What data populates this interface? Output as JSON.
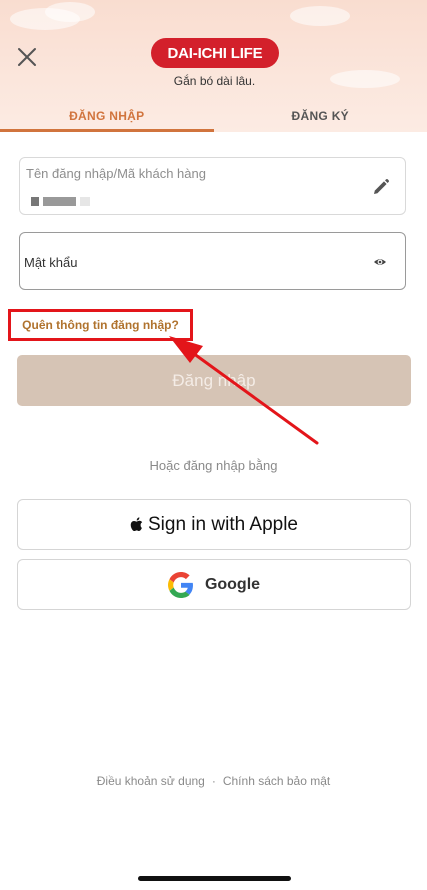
{
  "header": {
    "logo_text": "DAI-ICHI LIFE",
    "tagline": "Gắn bó dài lâu.",
    "close_icon": "close-icon",
    "brand_color": "#d3202b"
  },
  "tabs": [
    {
      "label": "ĐĂNG NHẬP",
      "active": true
    },
    {
      "label": "ĐĂNG KÝ",
      "active": false
    }
  ],
  "form": {
    "username_label": "Tên đăng nhập/Mã khách hàng",
    "password_label": "Mật khẩu",
    "forgot_link": "Quên thông tin đăng nhập?",
    "login_button": "Đăng nhập",
    "edit_icon": "pencil-icon",
    "visibility_icon": "eye-icon"
  },
  "social": {
    "or_text": "Hoặc đăng nhập bằng",
    "apple_label": "Sign in with Apple",
    "google_label": "Google"
  },
  "footer": {
    "terms": "Điều khoản sử dụng",
    "separator": "·",
    "privacy": "Chính sách bảo mật"
  },
  "colors": {
    "accent": "#d1743d",
    "highlight_box": "#e3151a",
    "disabled_button": "#d6c4b5",
    "forgot_link": "#b0732e"
  }
}
